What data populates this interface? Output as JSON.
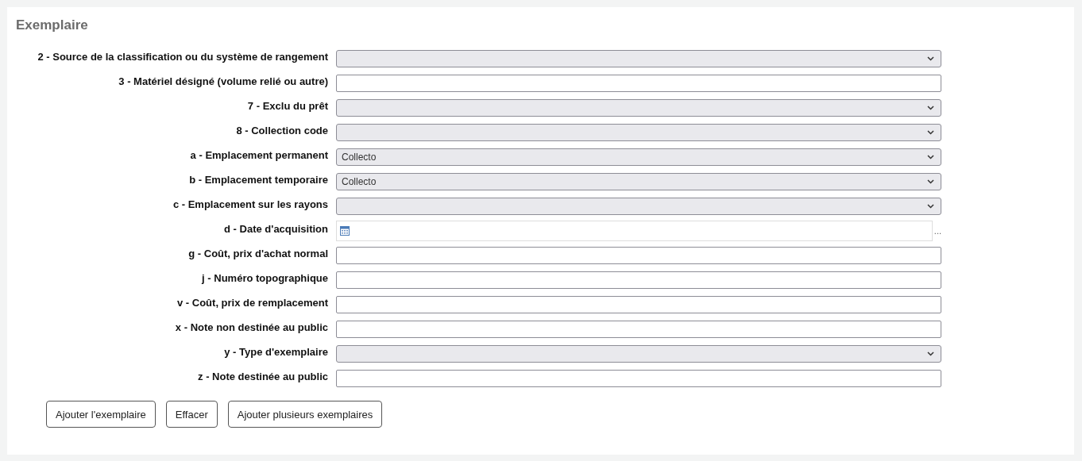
{
  "title": "Exemplaire",
  "fields": [
    {
      "label": "2 - Source de la classification ou du système de rangement",
      "kind": "select"
    },
    {
      "label": "3 - Matériel désigné (volume relié ou autre)",
      "kind": "text"
    },
    {
      "label": "7 - Exclu du prêt",
      "kind": "select"
    },
    {
      "label": "8 - Collection code",
      "kind": "select"
    },
    {
      "label": "a - Emplacement permanent",
      "kind": "select",
      "value": "Collecto"
    },
    {
      "label": "b - Emplacement temporaire",
      "kind": "select",
      "value": "Collecto"
    },
    {
      "label": "c - Emplacement sur les rayons",
      "kind": "select"
    },
    {
      "label": "d - Date d'acquisition",
      "kind": "date",
      "suffix": "..."
    },
    {
      "label": "g - Coût, prix d'achat normal",
      "kind": "text"
    },
    {
      "label": "j - Numéro topographique",
      "kind": "text"
    },
    {
      "label": "v - Coût, prix de remplacement",
      "kind": "text"
    },
    {
      "label": "x - Note non destinée au public",
      "kind": "text"
    },
    {
      "label": "y - Type d'exemplaire",
      "kind": "select"
    },
    {
      "label": "z - Note destinée au public",
      "kind": "text"
    }
  ],
  "buttons": [
    "Ajouter l'exemplaire",
    "Effacer",
    "Ajouter plusieurs exemplaires"
  ]
}
